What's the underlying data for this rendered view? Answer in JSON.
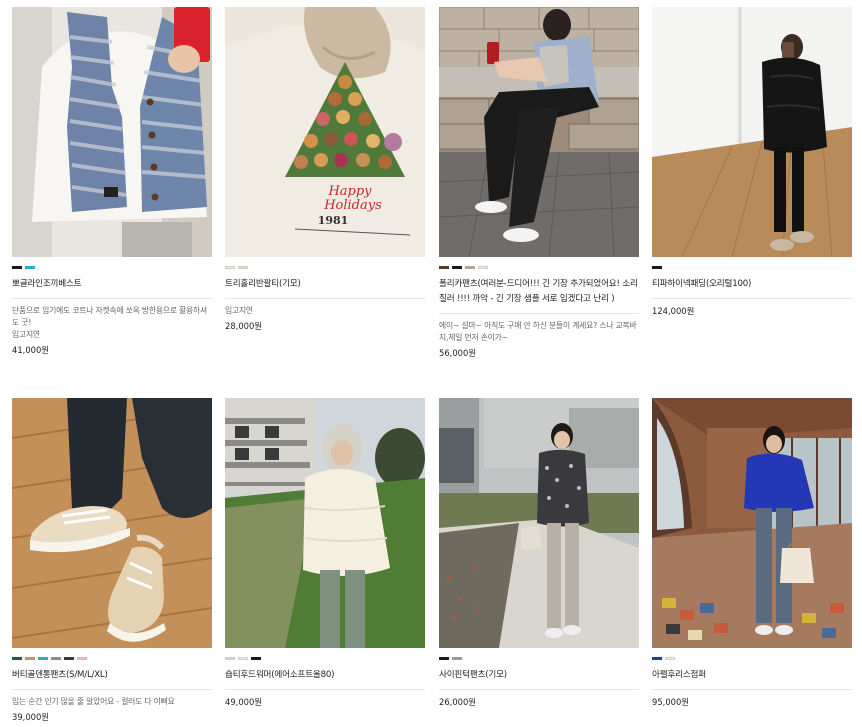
{
  "products": [
    {
      "name": "뽀글라인조끼베스트",
      "swatches": [
        "#1a1a1a",
        "#2aa8d6"
      ],
      "description": "단품으로 입기에도 코트나 자켓속에 쏘옥 방한용으로 활용하셔도 굿!",
      "tag": "입고지연",
      "price": "41,000원"
    },
    {
      "name": "트리홀리반팔티(기모)",
      "swatches": [
        "#f4efe2",
        "#e6d9bd"
      ],
      "description": "",
      "tag": "입고지연",
      "price": "28,000원"
    },
    {
      "name": "폴리카팬츠(여러분-드디어!!! 긴 기장 추가되었어요! 소리질러 !!!! 까악 - 긴 기장 샘플 서로 입겠다고 난리 )",
      "swatches": [
        "#5a3a2a",
        "#1a1a1a",
        "#b8a48a",
        "#f2ede4"
      ],
      "description": "에이~ 설마~ 아직도 구매 안 하신 분들이 계세요? 스나 교복바지,제일 먼저 손이가~",
      "tag": "",
      "price": "56,000원"
    },
    {
      "name": "티파하이넥패딩(오리털100)",
      "swatches": [
        "#1a1a1a"
      ],
      "description": "",
      "tag": "",
      "price": "124,000원"
    },
    {
      "name": "버티골덴통팬츠(S/M/L/XL)",
      "swatches": [
        "#1f5a3a",
        "#b89878",
        "#2aa8d6",
        "#8a8a8a",
        "#3a3a3a",
        "#e6b8c4"
      ],
      "description": "입는 순간 인기 많을 줄 알았어요 - 컬러도 다 이뻐요",
      "tag": "",
      "price": "39,000원"
    },
    {
      "name": "숍티후드워머(에어소프트울80)",
      "swatches": [
        "#ddd0b8",
        "#f2ede4",
        "#1a1a1a"
      ],
      "description": "",
      "tag": "",
      "price": "49,000원"
    },
    {
      "name": "사이핀턱팬츠(기모)",
      "swatches": [
        "#1a1a1a",
        "#9a9a9a"
      ],
      "description": "",
      "tag": "",
      "price": "26,000원"
    },
    {
      "name": "아펠후리스점퍼",
      "swatches": [
        "#1e3ca8",
        "#f2ede4"
      ],
      "description": "",
      "tag": "",
      "price": "95,000원"
    }
  ],
  "photo_texts": {
    "hoodie_print_line1": "Happy",
    "hoodie_print_line2": "Holidays",
    "hoodie_print_year": "1981"
  }
}
